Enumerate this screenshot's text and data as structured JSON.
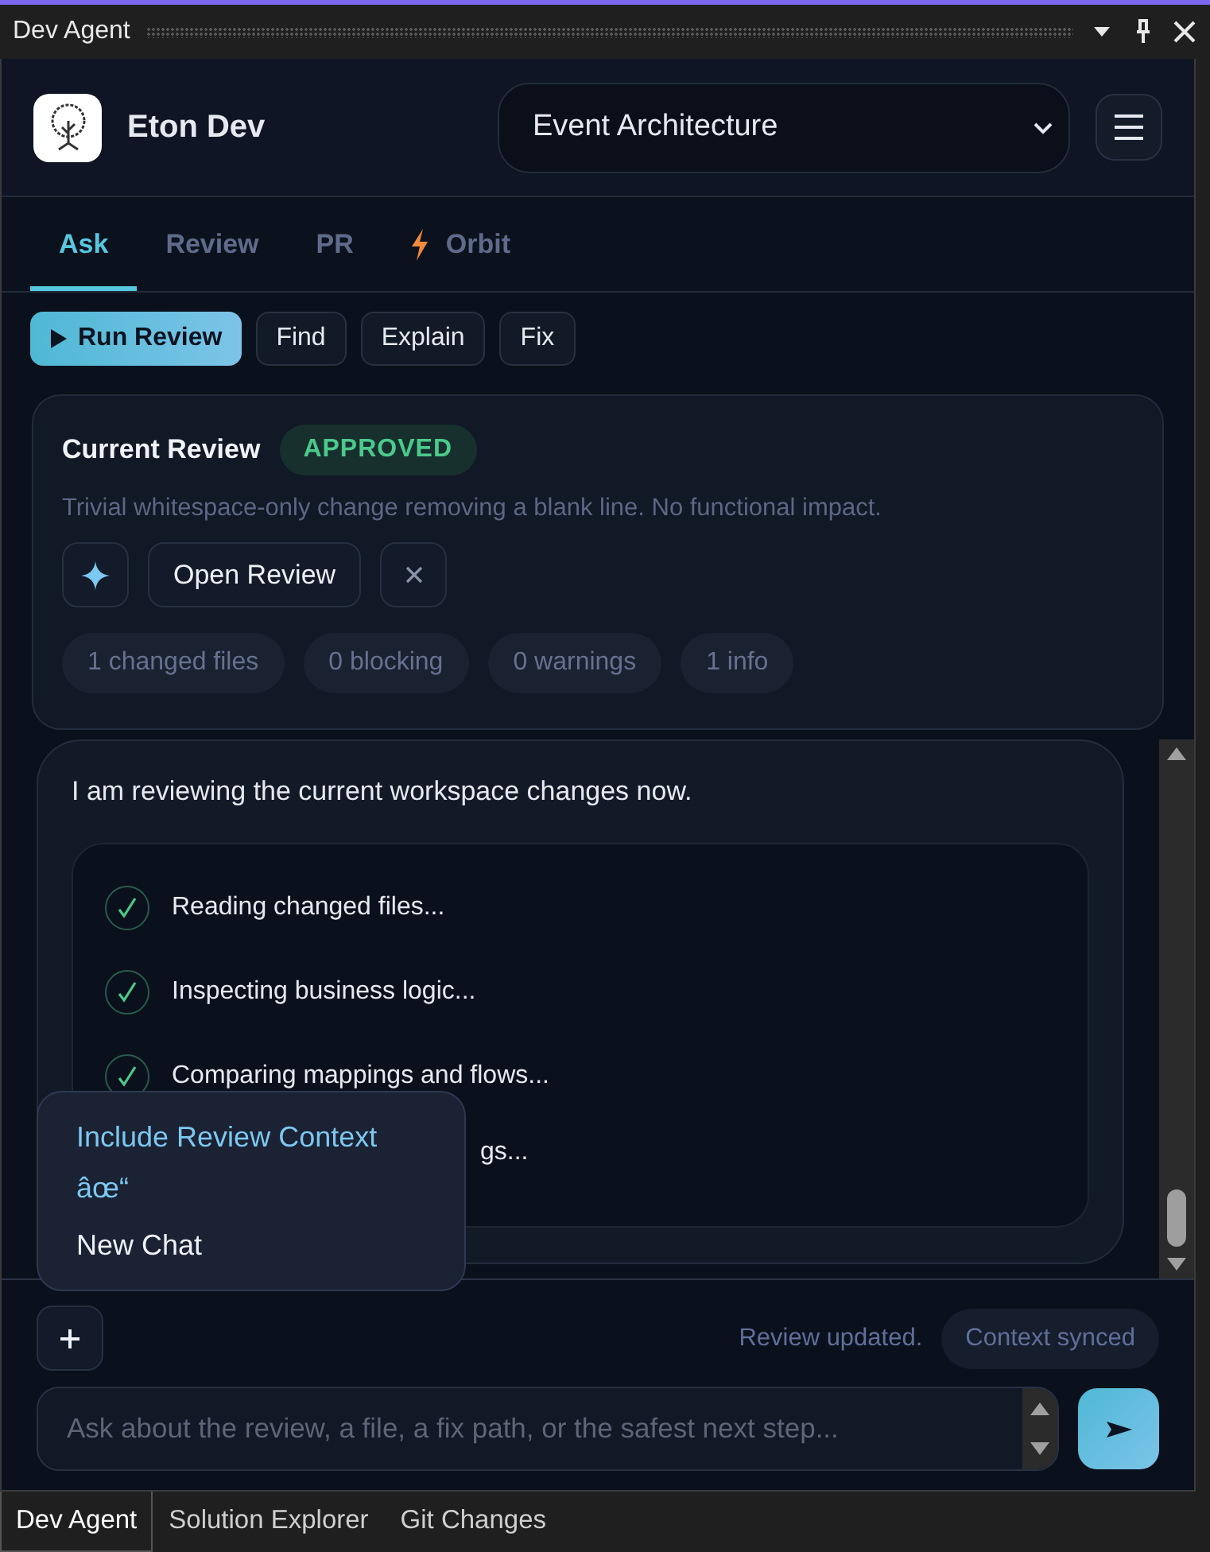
{
  "panel": {
    "title": "Dev Agent"
  },
  "header": {
    "app_name": "Eton Dev",
    "project": "Event Architecture"
  },
  "tabs": [
    {
      "label": "Ask",
      "selected": true,
      "kind": "plain"
    },
    {
      "label": "Review",
      "selected": false,
      "kind": "plain"
    },
    {
      "label": "PR",
      "selected": false,
      "kind": "plain"
    },
    {
      "label": "Orbit",
      "selected": false,
      "kind": "bolt"
    }
  ],
  "actions": [
    {
      "label": "Run Review",
      "kind": "primary"
    },
    {
      "label": "Find",
      "kind": "plain"
    },
    {
      "label": "Explain",
      "kind": "plain"
    },
    {
      "label": "Fix",
      "kind": "plain"
    }
  ],
  "review": {
    "title": "Current Review",
    "status": "APPROVED",
    "summary": "Trivial whitespace-only change removing a blank line. No functional impact.",
    "open_button": "Open Review",
    "stats": [
      "1 changed files",
      "0 blocking",
      "0 warnings",
      "1 info"
    ]
  },
  "chat": {
    "message": "I am reviewing the current workspace changes now.",
    "steps": [
      {
        "label": "Reading changed files...",
        "done": true
      },
      {
        "label": "Inspecting business logic...",
        "done": true
      },
      {
        "label": "Comparing mappings and flows...",
        "done": true
      },
      {
        "label": "gs...",
        "kind": "clipped"
      }
    ]
  },
  "menu": {
    "items": [
      {
        "label": "Include Review Context âœ“",
        "selected": true
      },
      {
        "label": "New Chat",
        "selected": false
      }
    ]
  },
  "composer": {
    "status": "Review updated.",
    "badge": "Context synced",
    "placeholder": "Ask about the review, a file, a fix path, or the safest next step..."
  },
  "bottom_tabs": [
    {
      "label": "Dev Agent",
      "selected": true
    },
    {
      "label": "Solution Explorer",
      "selected": false
    },
    {
      "label": "Git Changes",
      "selected": false
    }
  ]
}
